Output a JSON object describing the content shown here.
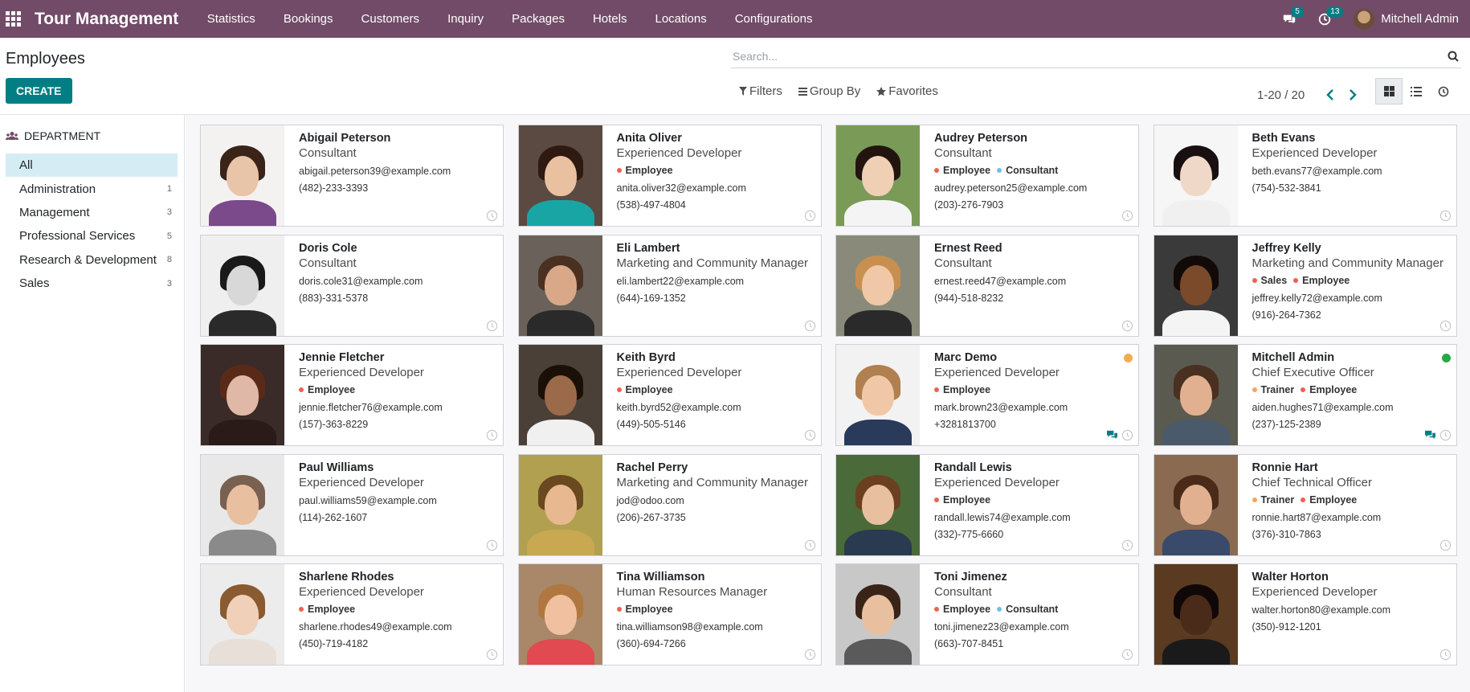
{
  "app": {
    "title": "Tour Management",
    "menu": [
      "Statistics",
      "Bookings",
      "Customers",
      "Inquiry",
      "Packages",
      "Hotels",
      "Locations",
      "Configurations"
    ],
    "messages_badge": "5",
    "activities_badge": "13",
    "user_name": "Mitchell Admin"
  },
  "page": {
    "title": "Employees",
    "create_label": "CREATE",
    "search_placeholder": "Search...",
    "filters_label": "Filters",
    "group_by_label": "Group By",
    "favorites_label": "Favorites",
    "pager": "1-20 / 20"
  },
  "sidebar": {
    "header": "DEPARTMENT",
    "items": [
      {
        "label": "All",
        "count": "",
        "active": true
      },
      {
        "label": "Administration",
        "count": "1"
      },
      {
        "label": "Management",
        "count": "3"
      },
      {
        "label": "Professional Services",
        "count": "5"
      },
      {
        "label": "Research & Development",
        "count": "8"
      },
      {
        "label": "Sales",
        "count": "3"
      }
    ]
  },
  "colors": {
    "navbar": "#714b67",
    "primary": "#017e84",
    "tag_employee": "#f06050",
    "tag_consultant": "#6cc1ed",
    "tag_sales": "#f06050",
    "tag_trainer": "#f4a460",
    "presence_away": "#f0ad4e",
    "presence_online": "#28a745"
  },
  "employees": [
    {
      "name": "Abigail Peterson",
      "job": "Consultant",
      "tags": [],
      "email": "abigail.peterson39@example.com",
      "phone": "(482)-233-3393",
      "skin": "#e8c4a8",
      "hair": "#3a2418",
      "shirt": "#7a4a8a",
      "bg": "#f4f2f0"
    },
    {
      "name": "Anita Oliver",
      "job": "Experienced Developer",
      "tags": [
        {
          "label": "Employee",
          "color": "#f06050"
        }
      ],
      "email": "anita.oliver32@example.com",
      "phone": "(538)-497-4804",
      "skin": "#e9c0a0",
      "hair": "#2e1a10",
      "shirt": "#1aa5a5",
      "bg": "#5a4a42"
    },
    {
      "name": "Audrey Peterson",
      "job": "Consultant",
      "tags": [
        {
          "label": "Employee",
          "color": "#f06050"
        },
        {
          "label": "Consultant",
          "color": "#6cc1ed"
        }
      ],
      "email": "audrey.peterson25@example.com",
      "phone": "(203)-276-7903",
      "skin": "#f0d0b4",
      "hair": "#221510",
      "shirt": "#f4f4f4",
      "bg": "#7a9a58"
    },
    {
      "name": "Beth Evans",
      "job": "Experienced Developer",
      "tags": [],
      "email": "beth.evans77@example.com",
      "phone": "(754)-532-3841",
      "skin": "#f0d8c8",
      "hair": "#181010",
      "shirt": "#f0f0f0",
      "bg": "#f6f6f6"
    },
    {
      "name": "Doris Cole",
      "job": "Consultant",
      "tags": [],
      "email": "doris.cole31@example.com",
      "phone": "(883)-331-5378",
      "skin": "#d8d8d8",
      "hair": "#1a1a1a",
      "shirt": "#2a2a2a",
      "bg": "#efefef"
    },
    {
      "name": "Eli Lambert",
      "job": "Marketing and Community Manager",
      "tags": [],
      "email": "eli.lambert22@example.com",
      "phone": "(644)-169-1352",
      "skin": "#d8a888",
      "hair": "#4a3020",
      "shirt": "#2a2a2a",
      "bg": "#6a625a"
    },
    {
      "name": "Ernest Reed",
      "job": "Consultant",
      "tags": [],
      "email": "ernest.reed47@example.com",
      "phone": "(944)-518-8232",
      "skin": "#f0c8a8",
      "hair": "#c89050",
      "shirt": "#2a2a2a",
      "bg": "#8a8a7a"
    },
    {
      "name": "Jeffrey Kelly",
      "job": "Marketing and Community Manager",
      "tags": [
        {
          "label": "Sales",
          "color": "#f06050"
        },
        {
          "label": "Employee",
          "color": "#f06050"
        }
      ],
      "email": "jeffrey.kelly72@example.com",
      "phone": "(916)-264-7362",
      "skin": "#7a4a2a",
      "hair": "#120a08",
      "shirt": "#f4f4f4",
      "bg": "#3a3a3a"
    },
    {
      "name": "Jennie Fletcher",
      "job": "Experienced Developer",
      "tags": [
        {
          "label": "Employee",
          "color": "#f06050"
        }
      ],
      "email": "jennie.fletcher76@example.com",
      "phone": "(157)-363-8229",
      "skin": "#e0b8a8",
      "hair": "#5a2a18",
      "shirt": "#2a1a18",
      "bg": "#3a2a28"
    },
    {
      "name": "Keith Byrd",
      "job": "Experienced Developer",
      "tags": [
        {
          "label": "Employee",
          "color": "#f06050"
        }
      ],
      "email": "keith.byrd52@example.com",
      "phone": "(449)-505-5146",
      "skin": "#9a6a4a",
      "hair": "#1a1008",
      "shirt": "#f0f0f0",
      "bg": "#4a4038"
    },
    {
      "name": "Marc Demo",
      "job": "Experienced Developer",
      "tags": [
        {
          "label": "Employee",
          "color": "#f06050"
        }
      ],
      "email": "mark.brown23@example.com",
      "phone": "+3281813700",
      "presence": "#f0ad4e",
      "chat": true,
      "skin": "#f0c8a8",
      "hair": "#b08050",
      "shirt": "#2a3a5a",
      "bg": "#f2f2f2"
    },
    {
      "name": "Mitchell Admin",
      "job": "Chief Executive Officer",
      "tags": [
        {
          "label": "Trainer",
          "color": "#f4a460"
        },
        {
          "label": "Employee",
          "color": "#f06050"
        }
      ],
      "email": "aiden.hughes71@example.com",
      "phone": "(237)-125-2389",
      "presence": "#28a745",
      "chat": true,
      "skin": "#e0b090",
      "hair": "#4a3020",
      "shirt": "#4a5a6a",
      "bg": "#5a5a50"
    },
    {
      "name": "Paul Williams",
      "job": "Experienced Developer",
      "tags": [],
      "email": "paul.williams59@example.com",
      "phone": "(114)-262-1607",
      "skin": "#e8c0a0",
      "hair": "#7a6050",
      "shirt": "#8a8a8a",
      "bg": "#e8e8e8"
    },
    {
      "name": "Rachel Perry",
      "job": "Marketing and Community Manager",
      "tags": [],
      "email": "jod@odoo.com",
      "phone": "(206)-267-3735",
      "skin": "#e8b890",
      "hair": "#6a4820",
      "shirt": "#c8a850",
      "bg": "#b0a050"
    },
    {
      "name": "Randall Lewis",
      "job": "Experienced Developer",
      "tags": [
        {
          "label": "Employee",
          "color": "#f06050"
        }
      ],
      "email": "randall.lewis74@example.com",
      "phone": "(332)-775-6660",
      "skin": "#e8c0a0",
      "hair": "#6a4020",
      "shirt": "#2a3a50",
      "bg": "#4a6a3a"
    },
    {
      "name": "Ronnie Hart",
      "job": "Chief Technical Officer",
      "tags": [
        {
          "label": "Trainer",
          "color": "#f4a460"
        },
        {
          "label": "Employee",
          "color": "#f06050"
        }
      ],
      "email": "ronnie.hart87@example.com",
      "phone": "(376)-310-7863",
      "skin": "#e0b090",
      "hair": "#4a2a18",
      "shirt": "#3a4a6a",
      "bg": "#8a6a50"
    },
    {
      "name": "Sharlene Rhodes",
      "job": "Experienced Developer",
      "tags": [
        {
          "label": "Employee",
          "color": "#f06050"
        }
      ],
      "email": "sharlene.rhodes49@example.com",
      "phone": "(450)-719-4182",
      "skin": "#f0d0b8",
      "hair": "#8a5a30",
      "shirt": "#e8e0d8",
      "bg": "#ececec"
    },
    {
      "name": "Tina Williamson",
      "job": "Human Resources Manager",
      "tags": [
        {
          "label": "Employee",
          "color": "#f06050"
        }
      ],
      "email": "tina.williamson98@example.com",
      "phone": "(360)-694-7266",
      "skin": "#f0c0a0",
      "hair": "#b07840",
      "shirt": "#e04a50",
      "bg": "#a88868"
    },
    {
      "name": "Toni Jimenez",
      "job": "Consultant",
      "tags": [
        {
          "label": "Employee",
          "color": "#f06050"
        },
        {
          "label": "Consultant",
          "color": "#6cc1ed"
        }
      ],
      "email": "toni.jimenez23@example.com",
      "phone": "(663)-707-8451",
      "skin": "#e8c0a0",
      "hair": "#3a2418",
      "shirt": "#5a5a5a",
      "bg": "#c8c8c8"
    },
    {
      "name": "Walter Horton",
      "job": "Experienced Developer",
      "tags": [],
      "email": "walter.horton80@example.com",
      "phone": "(350)-912-1201",
      "skin": "#4a2a18",
      "hair": "#100808",
      "shirt": "#1a1a1a",
      "bg": "#5a3a20"
    }
  ]
}
